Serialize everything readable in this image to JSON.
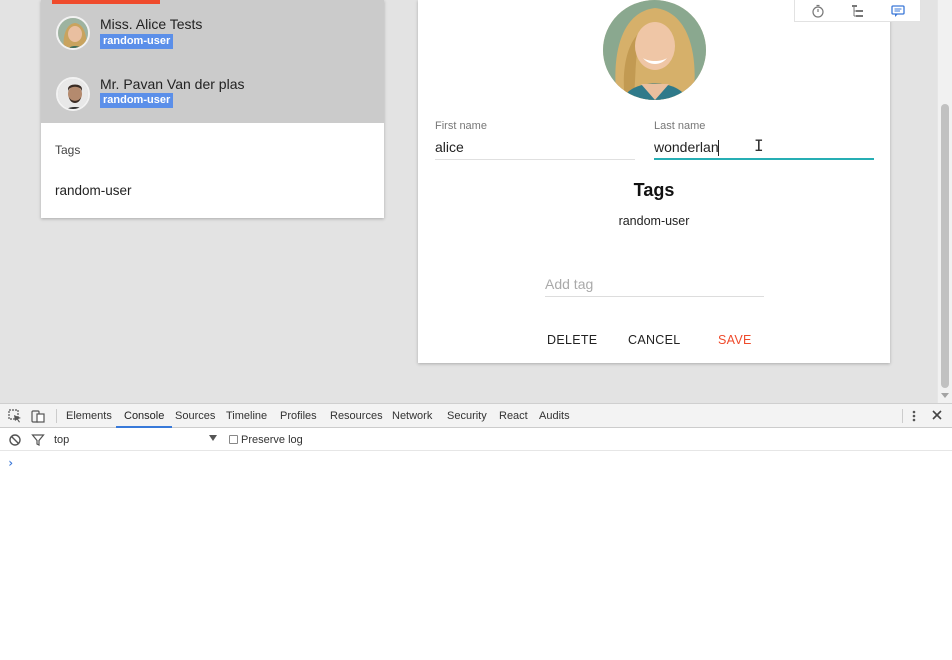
{
  "users": [
    {
      "name": "Miss. Alice Tests",
      "tag": "random-user"
    },
    {
      "name": "Mr. Pavan Van der plas",
      "tag": "random-user"
    }
  ],
  "list_tags": {
    "heading": "Tags",
    "value": "random-user"
  },
  "form": {
    "first_name_label": "First name",
    "first_name_value": "alice",
    "last_name_label": "Last name",
    "last_name_value": "wonderlan",
    "tags_title": "Tags",
    "tags_value": "random-user",
    "add_tag_placeholder": "Add tag",
    "delete_label": "DELETE",
    "cancel_label": "CANCEL",
    "save_label": "SAVE"
  },
  "toolbar_icons": [
    "timer-icon",
    "tree-icon",
    "comment-icon"
  ],
  "devtools": {
    "tabs": [
      "Elements",
      "Console",
      "Sources",
      "Timeline",
      "Profiles",
      "Resources",
      "Network",
      "Security",
      "React",
      "Audits"
    ],
    "active_tab": "Console",
    "context": "top",
    "preserve_log": "Preserve log",
    "prompt": "›"
  },
  "colors": {
    "accent": "#ef4b2c",
    "badge": "#5b8fe9",
    "focus_underline": "#26aeb4",
    "selected_row": "#cbcbcb",
    "devtools_active": "#3879d9"
  }
}
